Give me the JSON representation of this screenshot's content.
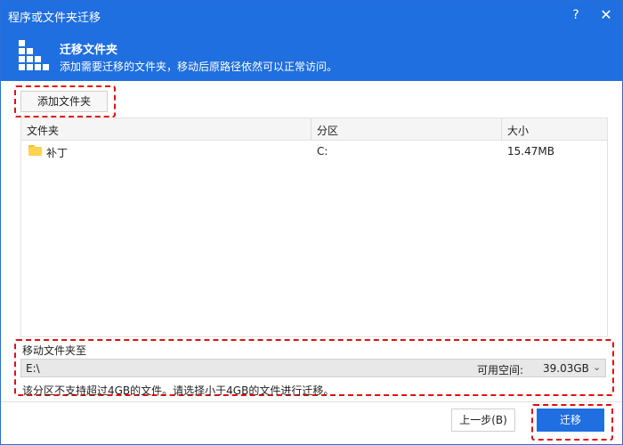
{
  "window": {
    "title": "程序或文件夹迁移",
    "help": "?",
    "close": "✕"
  },
  "header": {
    "title": "迁移文件夹",
    "description": "添加需要迁移的文件夹，移动后原路径依然可以正常访问。"
  },
  "toolbar": {
    "add_label": "添加文件夹"
  },
  "table": {
    "columns": [
      "文件夹",
      "分区",
      "大小"
    ],
    "rows": [
      {
        "name": "补丁",
        "partition": "C:",
        "size": "15.47MB",
        "icon": "folder-icon"
      }
    ]
  },
  "destination": {
    "label": "移动文件夹至",
    "path": "E:\\",
    "free_label": "可用空间:",
    "free_value": "39.03GB",
    "note": "该分区不支持超过4GB的文件。请选择小于4GB的文件进行迁移。"
  },
  "footer": {
    "prev_label": "上一步(B)",
    "migrate_label": "迁移"
  },
  "colors": {
    "accent": "#1f6fe0",
    "highlight": "#e01010"
  }
}
